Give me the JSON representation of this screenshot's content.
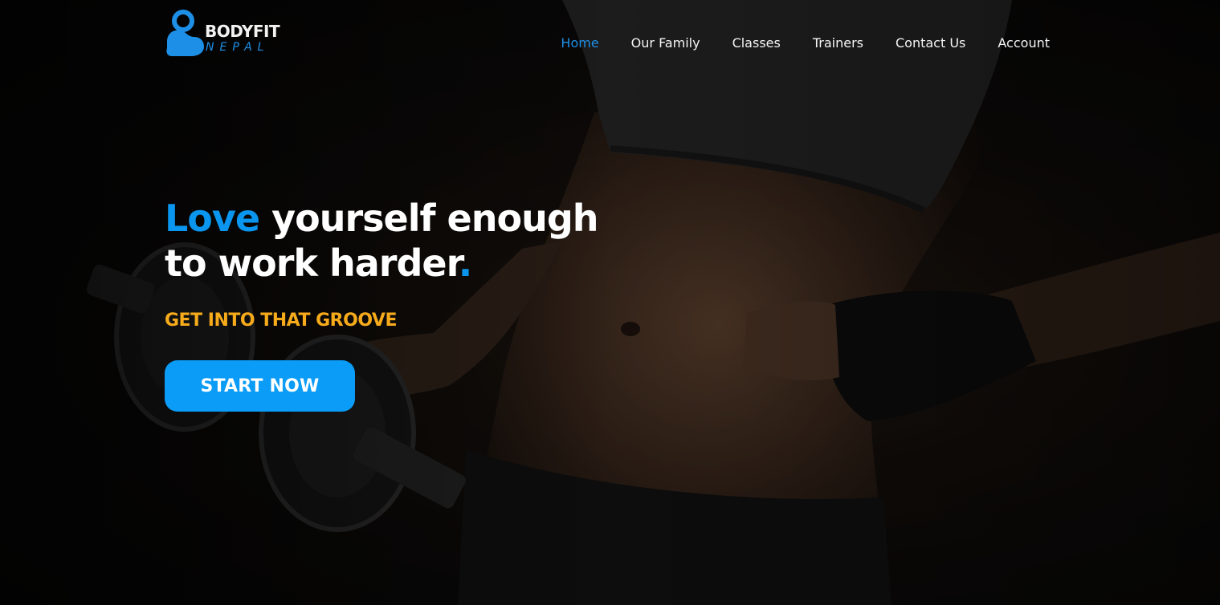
{
  "brand": {
    "logo_top": "BODYFIT",
    "logo_bottom": "NEPAL",
    "accent_color": "#0a9cf6"
  },
  "nav": {
    "items": [
      {
        "label": "Home",
        "active": true
      },
      {
        "label": "Our Family",
        "active": false
      },
      {
        "label": "Classes",
        "active": false
      },
      {
        "label": "Trainers",
        "active": false
      },
      {
        "label": "Contact Us",
        "active": false
      },
      {
        "label": "Account",
        "active": false
      }
    ]
  },
  "hero": {
    "headline_highlight": "Love",
    "headline_rest_line1": " yourself enough",
    "headline_line2": "to work harder",
    "headline_period": ".",
    "subheading": "GET INTO THAT GROOVE",
    "subheading_color": "#f7ab1b",
    "cta_label": "START NOW",
    "background_image": "woman-with-dumbbell-photo"
  }
}
